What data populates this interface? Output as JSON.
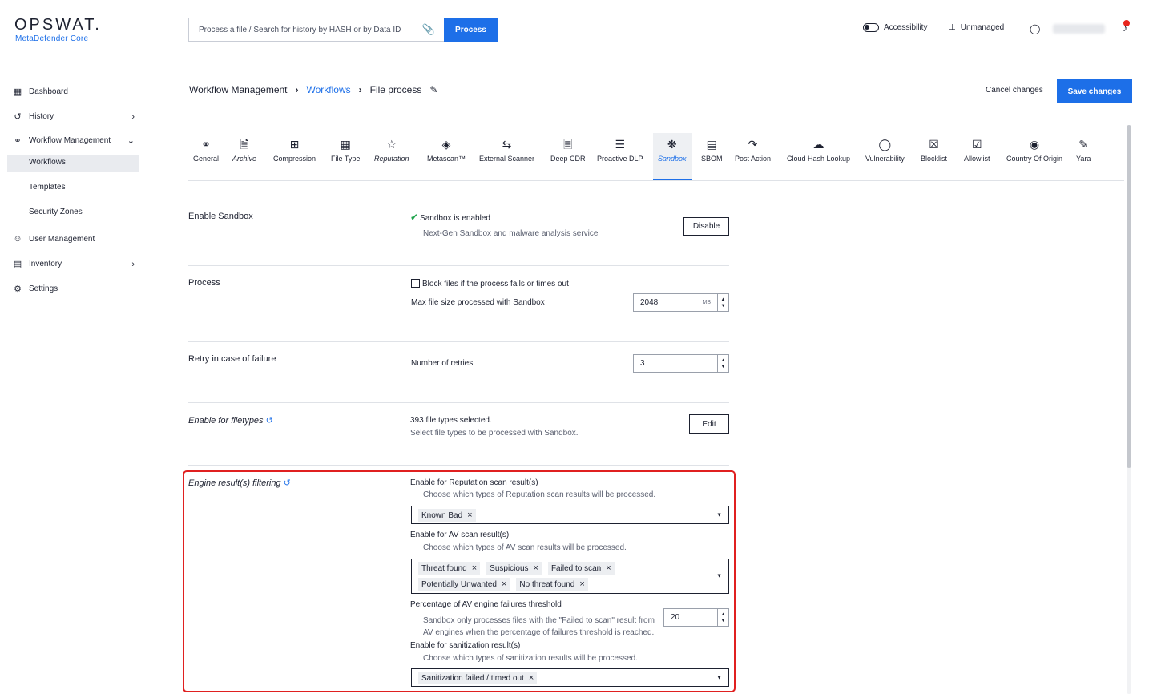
{
  "brand": {
    "name": "OPSWAT.",
    "product": "MetaDefender Core"
  },
  "search": {
    "placeholder": "Process a file / Search for history by HASH or by Data ID",
    "button": "Process"
  },
  "topbar": {
    "accessibility": "Accessibility",
    "unmanaged": "Unmanaged"
  },
  "sidebar": {
    "items": [
      {
        "label": "Dashboard"
      },
      {
        "label": "History"
      },
      {
        "label": "Workflow Management"
      },
      {
        "label": "User Management"
      },
      {
        "label": "Inventory"
      },
      {
        "label": "Settings"
      }
    ],
    "sub": [
      "Workflows",
      "Templates",
      "Security Zones"
    ]
  },
  "breadcrumb": {
    "root": "Workflow Management",
    "mid": "Workflows",
    "current": "File process"
  },
  "actions": {
    "cancel": "Cancel changes",
    "save": "Save changes"
  },
  "tabs": [
    "General",
    "Archive",
    "Compression",
    "File Type",
    "Reputation",
    "Metascan™",
    "External Scanner",
    "Deep CDR",
    "Proactive DLP",
    "Sandbox",
    "SBOM",
    "Post Action",
    "Cloud Hash Lookup",
    "Vulnerability",
    "Blocklist",
    "Allowlist",
    "Country Of Origin",
    "Yara"
  ],
  "enable_sandbox": {
    "title": "Enable Sandbox",
    "status": "Sandbox is enabled",
    "desc": "Next-Gen Sandbox and malware analysis service",
    "button": "Disable"
  },
  "process": {
    "title": "Process",
    "block_label": "Block files if the process fails or times out",
    "max_label": "Max file size processed with Sandbox",
    "max_value": "2048",
    "unit": "MB"
  },
  "retry": {
    "title": "Retry in case of failure",
    "label": "Number of retries",
    "value": "3"
  },
  "filetypes": {
    "title": "Enable for filetypes",
    "count": "393 file types selected.",
    "desc": "Select file types to be processed with Sandbox.",
    "button": "Edit"
  },
  "engine": {
    "title": "Engine result(s) filtering",
    "reputation": {
      "label": "Enable for Reputation scan result(s)",
      "desc": "Choose which types of Reputation scan results will be processed.",
      "chips": [
        "Known Bad"
      ]
    },
    "av": {
      "label": "Enable for AV scan result(s)",
      "desc": "Choose which types of AV scan results will be processed.",
      "chips": [
        "Threat found",
        "Suspicious",
        "Failed to scan",
        "Potentially Unwanted",
        "No threat found"
      ]
    },
    "threshold": {
      "label": "Percentage of AV engine failures threshold",
      "desc1": "Sandbox only processes files with the \"Failed to scan\" result from",
      "desc2": "AV engines when the percentage of failures threshold is reached.",
      "value": "20"
    },
    "sanitization": {
      "label": "Enable for sanitization result(s)",
      "desc": "Choose which types of sanitization results will be processed.",
      "chips": [
        "Sanitization failed / timed out"
      ]
    }
  }
}
